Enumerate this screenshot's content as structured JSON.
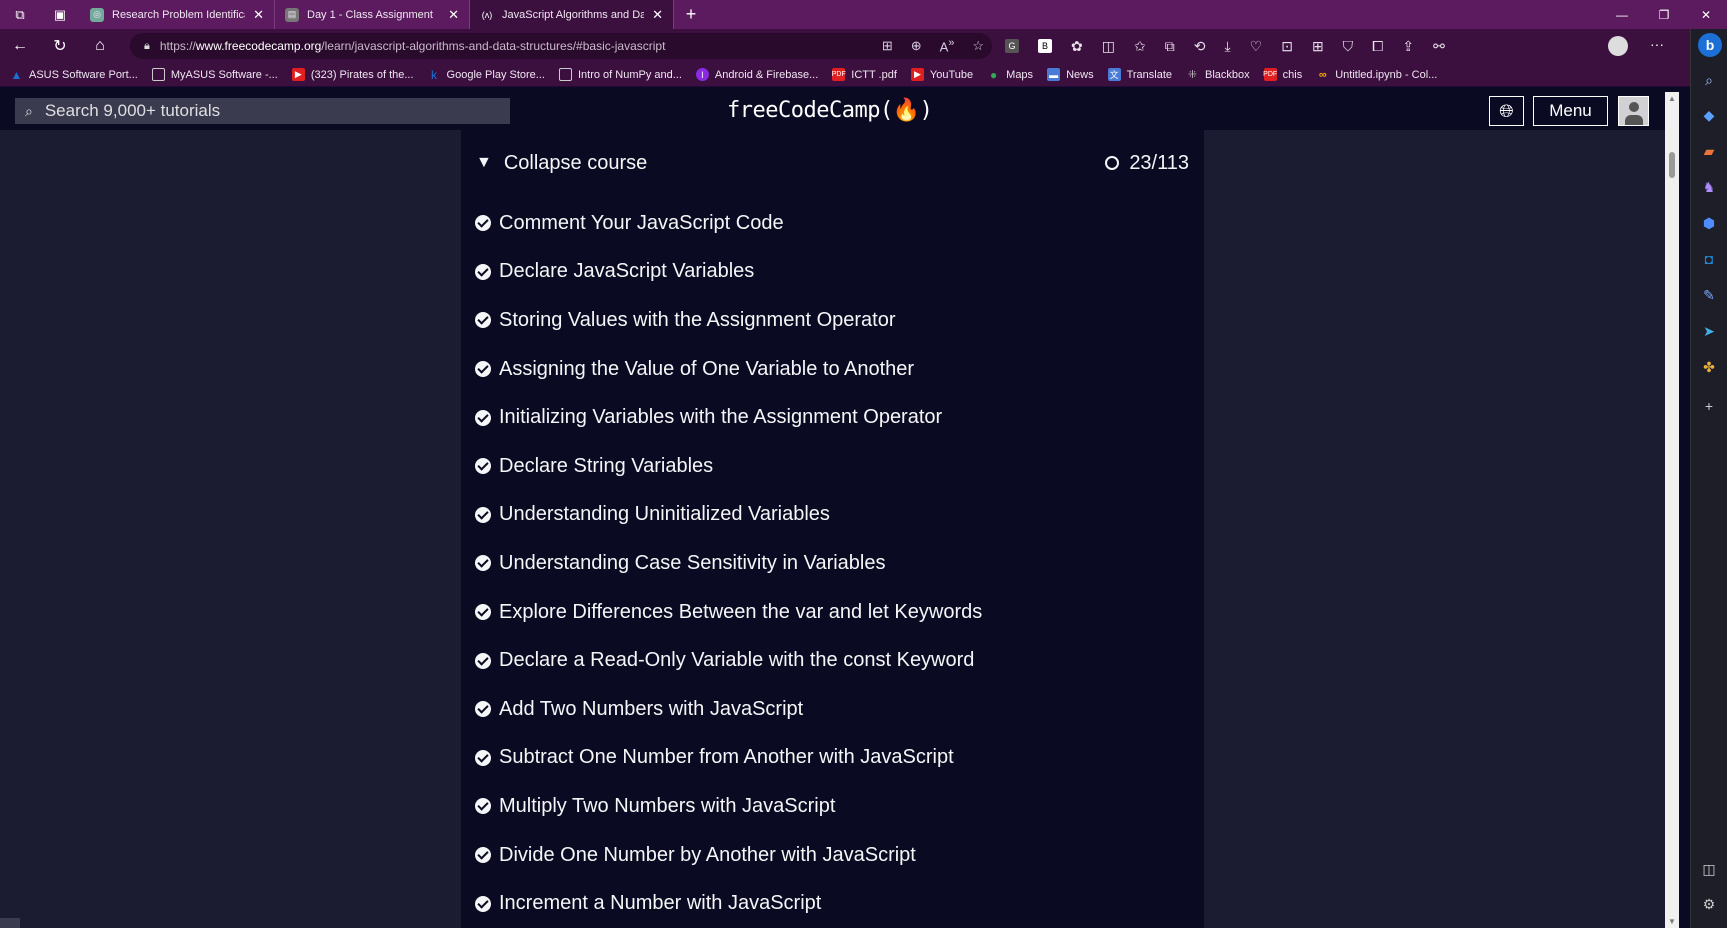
{
  "browser": {
    "tabs": [
      {
        "title": "Research Problem Identification (",
        "icon": "chatgpt-icon",
        "active": false
      },
      {
        "title": "Day 1 - Class Assignment",
        "icon": "classroom-icon",
        "active": false
      },
      {
        "title": "JavaScript Algorithms and Data S",
        "icon": "freecodecamp-icon",
        "active": true
      }
    ],
    "url": {
      "protocol": "https://",
      "host": "www.freecodecamp.org",
      "path": "/learn/javascript-algorithms-and-data-structures/#basic-javascript"
    },
    "bookmarks": [
      {
        "label": "ASUS Software Port...",
        "color": "#1b6fd6"
      },
      {
        "label": "MyASUS Software -...",
        "color": "#666666"
      },
      {
        "label": "(323) Pirates of the...",
        "color": "#e02020"
      },
      {
        "label": "Google Play Store...",
        "color": "#1b6fd6"
      },
      {
        "label": "Intro of NumPy and...",
        "color": "#666666"
      },
      {
        "label": "Android & Firebase...",
        "color": "#8a2be2"
      },
      {
        "label": "ICTT .pdf",
        "color": "#e02020"
      },
      {
        "label": "YouTube",
        "color": "#e02020"
      },
      {
        "label": "Maps",
        "color": "#34a853"
      },
      {
        "label": "News",
        "color": "#4a7bd6"
      },
      {
        "label": "Translate",
        "color": "#4a7bd6"
      },
      {
        "label": "Blackbox",
        "color": "#888888"
      },
      {
        "label": "chis",
        "color": "#e02020"
      },
      {
        "label": "Untitled.ipynb - Col...",
        "color": "#f9ab00"
      }
    ]
  },
  "fcc": {
    "search_placeholder": "Search 9,000+ tutorials",
    "logo": "freeCodeCamp(🔥)",
    "menu_label": "Menu",
    "collapse_label": "Collapse course",
    "progress": "23/113",
    "lessons": [
      "Comment Your JavaScript Code",
      "Declare JavaScript Variables",
      "Storing Values with the Assignment Operator",
      "Assigning the Value of One Variable to Another",
      "Initializing Variables with the Assignment Operator",
      "Declare String Variables",
      "Understanding Uninitialized Variables",
      "Understanding Case Sensitivity in Variables",
      "Explore Differences Between the var and let Keywords",
      "Declare a Read-Only Variable with the const Keyword",
      "Add Two Numbers with JavaScript",
      "Subtract One Number from Another with JavaScript",
      "Multiply Two Numbers with JavaScript",
      "Divide One Number by Another with JavaScript",
      "Increment a Number with JavaScript"
    ]
  },
  "colors": {
    "tab_bar": "#5b1b5e",
    "toolbar": "#3b0f3e",
    "page_bg": "#0a0a23",
    "side_bg": "#1b1b32"
  }
}
